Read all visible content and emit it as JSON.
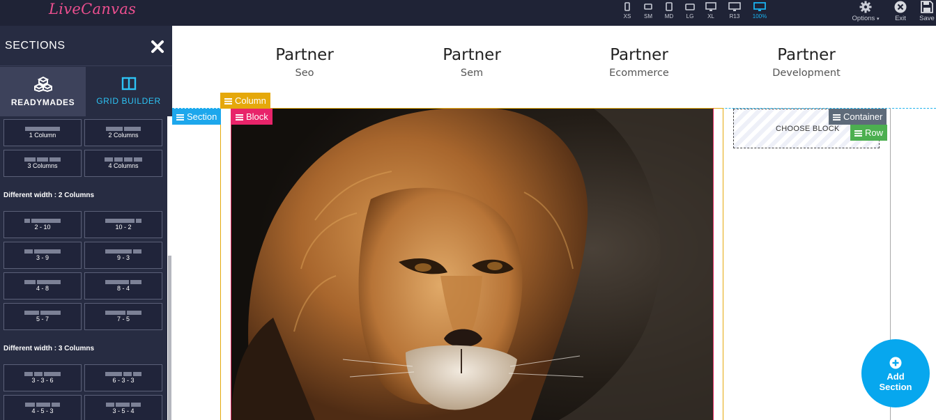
{
  "app": {
    "logo": "LiveCanvas"
  },
  "toolbar": {
    "devices": [
      {
        "label": "XS",
        "icon": "phone-icon"
      },
      {
        "label": "SM",
        "icon": "phone-landscape-icon"
      },
      {
        "label": "MD",
        "icon": "tablet-icon"
      },
      {
        "label": "LG",
        "icon": "tablet-landscape-icon"
      },
      {
        "label": "XL",
        "icon": "desktop-icon"
      },
      {
        "label": "R13",
        "icon": "desktop-icon"
      },
      {
        "label": "100%",
        "icon": "desktop-icon",
        "active": true
      }
    ],
    "options_label": "Options",
    "options_caret": "▾",
    "exit_label": "Exit",
    "save_label": "Save"
  },
  "sidebar": {
    "title": "SECTIONS",
    "tabs": [
      {
        "label": "READYMADES",
        "icon": "cubes-icon",
        "active": true
      },
      {
        "label": "GRID BUILDER",
        "icon": "grid-layout-icon",
        "active": false
      }
    ],
    "equal_items": [
      "1 Column",
      "2 Columns",
      "3 Columns",
      "4 Columns"
    ],
    "group2_title": "Different width : 2 Columns",
    "group2_items": [
      "2 - 10",
      "10 - 2",
      "3 - 9",
      "9 - 3",
      "4 - 8",
      "8 - 4",
      "5 - 7",
      "7 - 5"
    ],
    "group3_title": "Different width : 3 Columns",
    "group3_items": [
      "3 - 3 - 6",
      "6 - 3 - 3",
      "4 - 5 - 3",
      "3 - 5 - 4"
    ]
  },
  "canvas": {
    "partners": [
      {
        "title": "Partner",
        "subtitle": "Seo",
        "icon": "partner-seo-icon"
      },
      {
        "title": "Partner",
        "subtitle": "Sem",
        "icon": "partner-sem-icon"
      },
      {
        "title": "Partner",
        "subtitle": "Ecommerce",
        "icon": "partner-ecommerce-icon"
      },
      {
        "title": "Partner",
        "subtitle": "Development",
        "icon": "partner-development-icon"
      }
    ],
    "tags": {
      "section": "Section",
      "column": "Column",
      "block": "Block",
      "container": "Container",
      "row": "Row"
    },
    "choose_block": "CHOOSE BLOCK",
    "add_section": {
      "line1": "Add",
      "line2": "Section"
    }
  },
  "colors": {
    "topbar": "#1f2336",
    "sidebar": "#272c42",
    "accent_cyan": "#1da7ec",
    "column_tag": "#e5a80b",
    "block_tag": "#e8246a",
    "container_tag": "#5e6b7a",
    "row_tag": "#4caf50"
  }
}
